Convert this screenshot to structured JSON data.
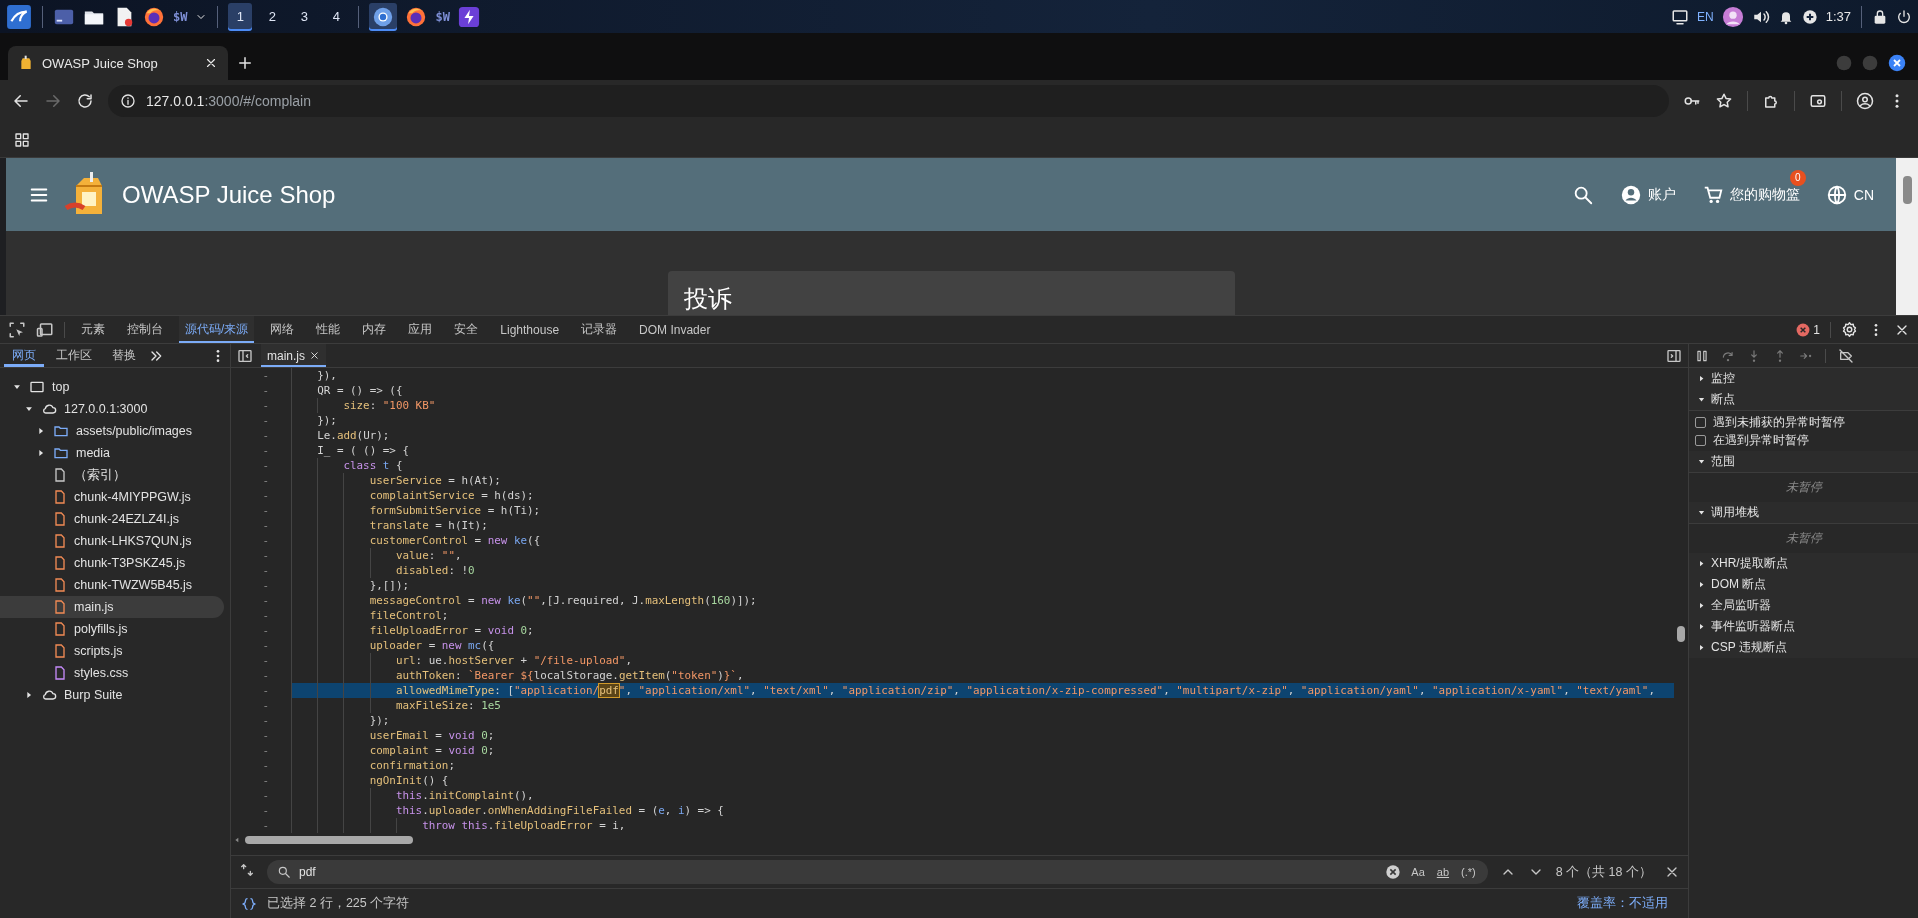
{
  "taskbar": {
    "pinned_label": "$W",
    "workspaces": [
      {
        "label": "1",
        "selected": true
      },
      {
        "label": "2",
        "selected": false
      },
      {
        "label": "3",
        "selected": false
      },
      {
        "label": "4",
        "selected": false
      }
    ],
    "running_label": "$W",
    "language": "EN",
    "clock": "1:37"
  },
  "browser": {
    "tab": {
      "title": "OWASP Juice Shop"
    },
    "address": {
      "host": "127.0.0.1",
      "path": ":3000/#/complain"
    }
  },
  "shop": {
    "title": "OWASP Juice Shop",
    "account": "账户",
    "basket": "您的购物篮",
    "basket_count": "0",
    "language": "CN",
    "card_title": "投诉"
  },
  "devtools": {
    "tabs": [
      {
        "label": "元素",
        "selected": false
      },
      {
        "label": "控制台",
        "selected": false
      },
      {
        "label": "源代码/来源",
        "selected": true
      },
      {
        "label": "网络",
        "selected": false
      },
      {
        "label": "性能",
        "selected": false
      },
      {
        "label": "内存",
        "selected": false
      },
      {
        "label": "应用",
        "selected": false
      },
      {
        "label": "安全",
        "selected": false
      },
      {
        "label": "Lighthouse",
        "selected": false
      },
      {
        "label": "记录器",
        "selected": false
      },
      {
        "label": "DOM Invader",
        "selected": false
      }
    ],
    "error_count": "1",
    "navigator_tabs": [
      {
        "label": "网页",
        "selected": true
      },
      {
        "label": "工作区",
        "selected": false
      },
      {
        "label": "替换",
        "selected": false
      }
    ],
    "tree": [
      {
        "label": "top",
        "kind": "frame",
        "expanded": true,
        "selected": false,
        "children": [
          {
            "label": "127.0.0.1:3000",
            "kind": "cloud",
            "expanded": true,
            "selected": false,
            "children": [
              {
                "label": "assets/public/images",
                "kind": "folder",
                "expanded": false,
                "selected": false
              },
              {
                "label": "media",
                "kind": "folder",
                "expanded": false,
                "selected": false
              },
              {
                "label": "（索引）",
                "kind": "document",
                "selected": false
              },
              {
                "label": "chunk-4MIYPPGW.js",
                "kind": "script",
                "selected": false
              },
              {
                "label": "chunk-24EZLZ4I.js",
                "kind": "script",
                "selected": false
              },
              {
                "label": "chunk-LHKS7QUN.js",
                "kind": "script",
                "selected": false
              },
              {
                "label": "chunk-T3PSKZ45.js",
                "kind": "script",
                "selected": false
              },
              {
                "label": "chunk-TWZW5B45.js",
                "kind": "script",
                "selected": false
              },
              {
                "label": "main.js",
                "kind": "script",
                "selected": true
              },
              {
                "label": "polyfills.js",
                "kind": "script",
                "selected": false
              },
              {
                "label": "scripts.js",
                "kind": "script",
                "selected": false
              },
              {
                "label": "styles.css",
                "kind": "stylesheet",
                "selected": false
              }
            ]
          },
          {
            "label": "Burp Suite",
            "kind": "cloud",
            "expanded": false,
            "selected": false
          }
        ]
      }
    ],
    "file_tab": "main.js",
    "code": [
      {
        "gutter": "-",
        "selected": false,
        "tokens": [
          {
            "kind": "plain",
            "text": "    }),"
          }
        ]
      },
      {
        "gutter": "-",
        "selected": false,
        "tokens": [
          {
            "kind": "plain",
            "text": "    QR = () => ({"
          }
        ]
      },
      {
        "gutter": "-",
        "selected": false,
        "tokens": [
          {
            "kind": "prop",
            "text": "        size"
          },
          {
            "kind": "plain",
            "text": ": "
          },
          {
            "kind": "string",
            "text": "\"100 KB\""
          }
        ]
      },
      {
        "gutter": "-",
        "selected": false,
        "tokens": [
          {
            "kind": "plain",
            "text": "    });"
          }
        ]
      },
      {
        "gutter": "-",
        "selected": false,
        "tokens": [
          {
            "kind": "plain",
            "text": "    Le."
          },
          {
            "kind": "prop",
            "text": "add"
          },
          {
            "kind": "plain",
            "text": "(Ur);"
          }
        ]
      },
      {
        "gutter": "-",
        "selected": false,
        "tokens": [
          {
            "kind": "plain",
            "text": "    I_ = ( () => {"
          }
        ]
      },
      {
        "gutter": "-",
        "selected": false,
        "tokens": [
          {
            "kind": "keyword",
            "text": "        class "
          },
          {
            "kind": "ident",
            "text": "t"
          },
          {
            "kind": "plain",
            "text": " {"
          }
        ]
      },
      {
        "gutter": "-",
        "selected": false,
        "tokens": [
          {
            "kind": "prop",
            "text": "            userService"
          },
          {
            "kind": "plain",
            "text": " = h(At);"
          }
        ]
      },
      {
        "gutter": "-",
        "selected": false,
        "tokens": [
          {
            "kind": "prop",
            "text": "            complaintService"
          },
          {
            "kind": "plain",
            "text": " = h(ds);"
          }
        ]
      },
      {
        "gutter": "-",
        "selected": false,
        "tokens": [
          {
            "kind": "prop",
            "text": "            formSubmitService"
          },
          {
            "kind": "plain",
            "text": " = h(Ti);"
          }
        ]
      },
      {
        "gutter": "-",
        "selected": false,
        "tokens": [
          {
            "kind": "prop",
            "text": "            translate"
          },
          {
            "kind": "plain",
            "text": " = h(It);"
          }
        ]
      },
      {
        "gutter": "-",
        "selected": false,
        "tokens": [
          {
            "kind": "prop",
            "text": "            customerControl"
          },
          {
            "kind": "plain",
            "text": " = "
          },
          {
            "kind": "keyword",
            "text": "new "
          },
          {
            "kind": "ident",
            "text": "ke"
          },
          {
            "kind": "plain",
            "text": "({"
          }
        ]
      },
      {
        "gutter": "-",
        "selected": false,
        "tokens": [
          {
            "kind": "prop",
            "text": "                value"
          },
          {
            "kind": "plain",
            "text": ": "
          },
          {
            "kind": "string",
            "text": "\"\""
          },
          {
            "kind": "plain",
            "text": ","
          }
        ]
      },
      {
        "gutter": "-",
        "selected": false,
        "tokens": [
          {
            "kind": "prop",
            "text": "                disabled"
          },
          {
            "kind": "plain",
            "text": ": !"
          },
          {
            "kind": "number",
            "text": "0"
          }
        ]
      },
      {
        "gutter": "-",
        "selected": false,
        "tokens": [
          {
            "kind": "plain",
            "text": "            },[]);"
          }
        ]
      },
      {
        "gutter": "-",
        "selected": false,
        "tokens": [
          {
            "kind": "prop",
            "text": "            messageControl"
          },
          {
            "kind": "plain",
            "text": " = "
          },
          {
            "kind": "keyword",
            "text": "new "
          },
          {
            "kind": "ident",
            "text": "ke"
          },
          {
            "kind": "plain",
            "text": "("
          },
          {
            "kind": "string",
            "text": "\"\""
          },
          {
            "kind": "plain",
            "text": ",[J.required, J."
          },
          {
            "kind": "prop",
            "text": "maxLength"
          },
          {
            "kind": "plain",
            "text": "("
          },
          {
            "kind": "number",
            "text": "160"
          },
          {
            "kind": "plain",
            "text": ")]);"
          }
        ]
      },
      {
        "gutter": "-",
        "selected": false,
        "tokens": [
          {
            "kind": "prop",
            "text": "            fileControl"
          },
          {
            "kind": "plain",
            "text": ";"
          }
        ]
      },
      {
        "gutter": "-",
        "selected": false,
        "tokens": [
          {
            "kind": "prop",
            "text": "            fileUploadError"
          },
          {
            "kind": "plain",
            "text": " = "
          },
          {
            "kind": "keyword",
            "text": "void "
          },
          {
            "kind": "number",
            "text": "0"
          },
          {
            "kind": "plain",
            "text": ";"
          }
        ]
      },
      {
        "gutter": "-",
        "selected": false,
        "tokens": [
          {
            "kind": "prop",
            "text": "            uploader"
          },
          {
            "kind": "plain",
            "text": " = "
          },
          {
            "kind": "keyword",
            "text": "new "
          },
          {
            "kind": "ident",
            "text": "mc"
          },
          {
            "kind": "plain",
            "text": "({"
          }
        ]
      },
      {
        "gutter": "-",
        "selected": false,
        "tokens": [
          {
            "kind": "prop",
            "text": "                url"
          },
          {
            "kind": "plain",
            "text": ": ue."
          },
          {
            "kind": "prop",
            "text": "hostServer"
          },
          {
            "kind": "plain",
            "text": " + "
          },
          {
            "kind": "string",
            "text": "\"/file-upload\""
          },
          {
            "kind": "plain",
            "text": ","
          }
        ]
      },
      {
        "gutter": "-",
        "selected": false,
        "tokens": [
          {
            "kind": "prop",
            "text": "                authToken"
          },
          {
            "kind": "plain",
            "text": ": "
          },
          {
            "kind": "string",
            "text": "`Bearer ${"
          },
          {
            "kind": "plain",
            "text": "localStorage."
          },
          {
            "kind": "prop",
            "text": "getItem"
          },
          {
            "kind": "plain",
            "text": "("
          },
          {
            "kind": "string",
            "text": "\"token\""
          },
          {
            "kind": "plain",
            "text": ")"
          },
          {
            "kind": "string",
            "text": "}`"
          },
          {
            "kind": "plain",
            "text": ","
          }
        ]
      },
      {
        "gutter": "-",
        "selected": true,
        "tokens": [
          {
            "kind": "prop",
            "text": "                allowedMimeType"
          },
          {
            "kind": "plain",
            "text": ": ["
          },
          {
            "kind": "string",
            "text": "\"application/"
          },
          {
            "kind": "match",
            "text": "pdf"
          },
          {
            "kind": "string",
            "text": "\""
          },
          {
            "kind": "plain",
            "text": ", "
          },
          {
            "kind": "string",
            "text": "\"application/xml\""
          },
          {
            "kind": "plain",
            "text": ", "
          },
          {
            "kind": "string",
            "text": "\"text/xml\""
          },
          {
            "kind": "plain",
            "text": ", "
          },
          {
            "kind": "string",
            "text": "\"application/zip\""
          },
          {
            "kind": "plain",
            "text": ", "
          },
          {
            "kind": "string",
            "text": "\"application/x-zip-compressed\""
          },
          {
            "kind": "plain",
            "text": ", "
          },
          {
            "kind": "string",
            "text": "\"multipart/x-zip\""
          },
          {
            "kind": "plain",
            "text": ", "
          },
          {
            "kind": "string",
            "text": "\"application/yaml\""
          },
          {
            "kind": "plain",
            "text": ", "
          },
          {
            "kind": "string",
            "text": "\"application/x-yaml\""
          },
          {
            "kind": "plain",
            "text": ", "
          },
          {
            "kind": "string",
            "text": "\"text/yaml\""
          },
          {
            "kind": "plain",
            "text": ","
          }
        ]
      },
      {
        "gutter": "-",
        "selected": false,
        "tokens": [
          {
            "kind": "prop",
            "text": "                maxFileSize"
          },
          {
            "kind": "plain",
            "text": ": "
          },
          {
            "kind": "number",
            "text": "1e5"
          }
        ]
      },
      {
        "gutter": "-",
        "selected": false,
        "tokens": [
          {
            "kind": "plain",
            "text": "            });"
          }
        ]
      },
      {
        "gutter": "-",
        "selected": false,
        "tokens": [
          {
            "kind": "prop",
            "text": "            userEmail"
          },
          {
            "kind": "plain",
            "text": " = "
          },
          {
            "kind": "keyword",
            "text": "void "
          },
          {
            "kind": "number",
            "text": "0"
          },
          {
            "kind": "plain",
            "text": ";"
          }
        ]
      },
      {
        "gutter": "-",
        "selected": false,
        "tokens": [
          {
            "kind": "prop",
            "text": "            complaint"
          },
          {
            "kind": "plain",
            "text": " = "
          },
          {
            "kind": "keyword",
            "text": "void "
          },
          {
            "kind": "number",
            "text": "0"
          },
          {
            "kind": "plain",
            "text": ";"
          }
        ]
      },
      {
        "gutter": "-",
        "selected": false,
        "tokens": [
          {
            "kind": "prop",
            "text": "            confirmation"
          },
          {
            "kind": "plain",
            "text": ";"
          }
        ]
      },
      {
        "gutter": "-",
        "selected": false,
        "tokens": [
          {
            "kind": "prop",
            "text": "            ngOnInit"
          },
          {
            "kind": "plain",
            "text": "() {"
          }
        ]
      },
      {
        "gutter": "-",
        "selected": false,
        "tokens": [
          {
            "kind": "keyword",
            "text": "                this"
          },
          {
            "kind": "plain",
            "text": "."
          },
          {
            "kind": "prop",
            "text": "initComplaint"
          },
          {
            "kind": "plain",
            "text": "(),"
          }
        ]
      },
      {
        "gutter": "-",
        "selected": false,
        "tokens": [
          {
            "kind": "keyword",
            "text": "                this"
          },
          {
            "kind": "plain",
            "text": "."
          },
          {
            "kind": "prop",
            "text": "uploader"
          },
          {
            "kind": "plain",
            "text": "."
          },
          {
            "kind": "prop",
            "text": "onWhenAddingFileFailed"
          },
          {
            "kind": "plain",
            "text": " = ("
          },
          {
            "kind": "ident",
            "text": "e"
          },
          {
            "kind": "plain",
            "text": ", "
          },
          {
            "kind": "ident",
            "text": "i"
          },
          {
            "kind": "plain",
            "text": ") => {"
          }
        ]
      },
      {
        "gutter": "-",
        "selected": false,
        "tokens": [
          {
            "kind": "keyword",
            "text": "                    throw this"
          },
          {
            "kind": "plain",
            "text": "."
          },
          {
            "kind": "prop",
            "text": "fileUploadError"
          },
          {
            "kind": "plain",
            "text": " = i,"
          }
        ]
      }
    ],
    "debugger": [
      {
        "title": "监控",
        "expanded": false
      },
      {
        "title": "断点",
        "expanded": true,
        "checkboxes": [
          {
            "label": "遇到未捕获的异常时暂停",
            "checked": false
          },
          {
            "label": "在遇到异常时暂停",
            "checked": false
          }
        ]
      },
      {
        "title": "范围",
        "expanded": true,
        "note": "未暂停"
      },
      {
        "title": "调用堆栈",
        "expanded": true,
        "note": "未暂停"
      },
      {
        "title": "XHR/提取断点",
        "expanded": false
      },
      {
        "title": "DOM 断点",
        "expanded": false
      },
      {
        "title": "全局监听器",
        "expanded": false
      },
      {
        "title": "事件监听器断点",
        "expanded": false
      },
      {
        "title": "CSP 违规断点",
        "expanded": false
      }
    ],
    "search": {
      "value": "pdf",
      "options": [
        "Aa",
        "ab",
        "(.*)"
      ],
      "result": "8 个（共 18 个）"
    },
    "status": {
      "selection": "已选择 2 行，225 个字符",
      "coverage": "覆盖率：不适用"
    }
  }
}
